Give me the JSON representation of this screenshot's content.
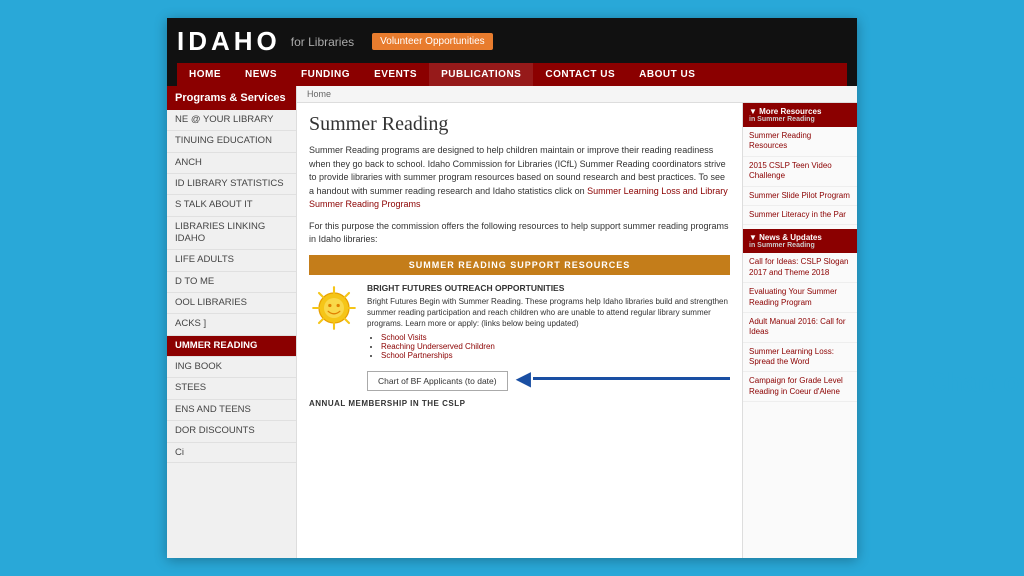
{
  "site": {
    "logo": "IDAHO",
    "logo_for": "for Libraries",
    "volunteer_btn": "Volunteer Opportunities"
  },
  "nav": {
    "items": [
      "HOME",
      "NEWS",
      "FUNDING",
      "EVENTS",
      "PUBLICATIONS",
      "CONTACT US",
      "ABOUT US"
    ]
  },
  "sidebar": {
    "header": "Programs & Services",
    "items": [
      "NE @ YOUR LIBRARY",
      "TINUING EDUCATION",
      "ANCH",
      "ID LIBRARY STATISTICS",
      "S TALK ABOUT IT",
      "LIBRARIES LINKING IDAHO",
      "LIFE ADULTS",
      "D TO ME",
      "OOL LIBRARIES",
      "ACKS ]",
      "UMMER READING",
      "ING BOOK",
      "STEES",
      "ENS AND TEENS",
      "DOR DISCOUNTS"
    ],
    "active_index": 10
  },
  "breadcrumb": "Home",
  "page": {
    "title": "Summer Reading",
    "intro1": "Summer Reading programs are designed to help children maintain or improve their reading readiness when they go back to school. Idaho Commission for Libraries (ICfL) Summer Reading coordinators strive to provide libraries with summer program resources based on sound research and best practices. To see a handout with summer reading research and Idaho statistics click on",
    "intro_link": "Summer Learning Loss and Library Summer Reading Programs",
    "intro2": "For this purpose the commission offers the following resources to help support summer reading programs in Idaho libraries:",
    "section_header": "SUMMER READING SUPPORT RESOURCES",
    "outreach": {
      "title": "BRIGHT FUTURES OUTREACH OPPORTUNITIES",
      "text": "Bright Futures Begin with Summer Reading. These programs help Idaho libraries build and strengthen summer reading participation and reach children who are unable to attend regular library summer programs. Learn more or apply: (links below being updated)",
      "links": [
        "School Visits",
        "Reaching Underserved Children",
        "School Partnerships"
      ],
      "chart_btn": "Chart of BF Applicants (to date)"
    }
  },
  "right_widgets": {
    "resources": {
      "header": "▼ More Resources",
      "sub": "in Summer Reading",
      "links": [
        "Summer Reading Resources",
        "2015 CSLP Teen Video Challenge",
        "Summer Slide Pilot Program",
        "Summer Literacy in the Par"
      ]
    },
    "news": {
      "header": "▼ News & Updates",
      "sub": "in Summer Reading",
      "links": [
        "Call for Ideas: CSLP Slogan 2017 and Theme 2018",
        "Evaluating Your Summer Reading Program",
        "Adult Manual 2016: Call for Ideas",
        "Summer Learning Loss: Spread the Word",
        "Campaign for Grade Level Reading in Coeur d'Alene"
      ]
    }
  },
  "big_label": "Chart of Applicants",
  "ci_item": "Ci"
}
